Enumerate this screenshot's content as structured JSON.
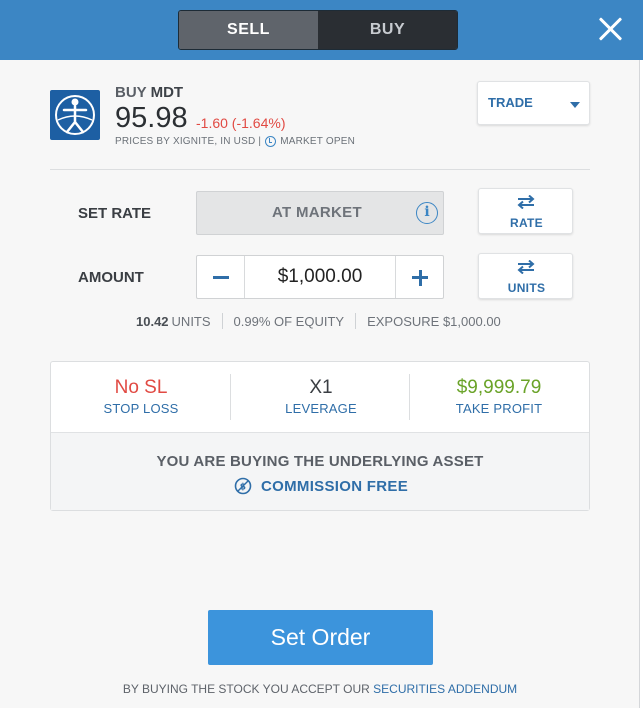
{
  "header": {
    "tabs": [
      {
        "label": "SELL",
        "selected": true
      },
      {
        "label": "BUY",
        "selected": false
      }
    ],
    "close_icon": "close-icon"
  },
  "instrument": {
    "action": "BUY",
    "symbol": "MDT",
    "price": "95.98",
    "change": "-1.60 (-1.64%)",
    "source": "PRICES BY XIGNITE, IN USD |",
    "market_status": "MARKET OPEN",
    "logo_icon": "medtronic-logo"
  },
  "trade_dropdown": {
    "label": "TRADE"
  },
  "set_rate": {
    "label": "SET RATE",
    "value": "AT MARKET",
    "info_glyph": "i",
    "toggle_label": "RATE"
  },
  "amount": {
    "label": "AMOUNT",
    "value": "$1,000.00",
    "toggle_label": "UNITS",
    "units_count": "10.42",
    "units_label": "UNITS",
    "equity": "0.99% OF EQUITY",
    "exposure": "EXPOSURE $1,000.00"
  },
  "order_options": {
    "stop_loss": {
      "value": "No SL",
      "label": "STOP LOSS"
    },
    "leverage": {
      "value": "X1",
      "label": "LEVERAGE"
    },
    "take_profit": {
      "value": "$9,999.79",
      "label": "TAKE PROFIT"
    },
    "headline": "YOU ARE BUYING THE UNDERLYING ASSET",
    "commission": "COMMISSION FREE"
  },
  "set_order_button": "Set Order",
  "legal": {
    "text": "BY BUYING THE STOCK YOU ACCEPT OUR",
    "link": "SECURITIES ADDENDUM"
  },
  "colors": {
    "header_bg": "#3c86c4",
    "accent_blue": "#2f6ea8",
    "negative": "#e14a43",
    "positive": "#6aa328",
    "button_blue": "#3c94dc"
  }
}
